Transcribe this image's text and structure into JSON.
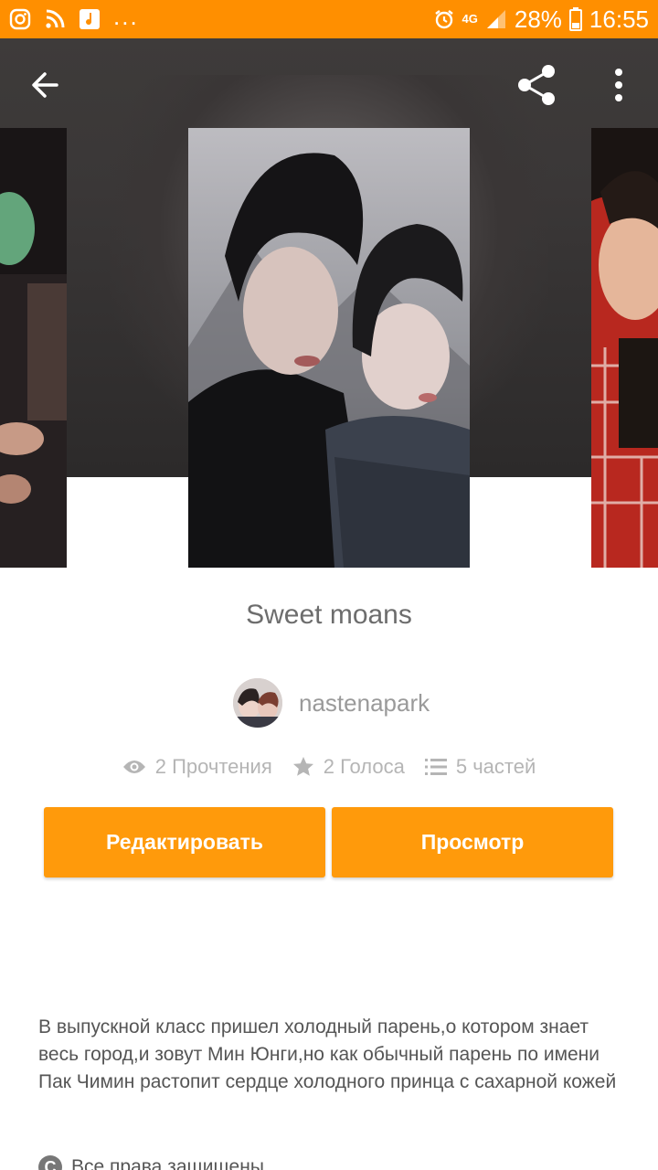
{
  "status_bar": {
    "icons_left": [
      "instagram-icon",
      "rss-icon",
      "music-icon"
    ],
    "more": "...",
    "network": "4G",
    "battery": "28%",
    "time": "16:55"
  },
  "toolbar": {
    "back_icon": "arrow-left-icon",
    "share_icon": "share-icon",
    "more_icon": "more-vertical-icon"
  },
  "story": {
    "title": "Sweet moans",
    "author": "nastenapark",
    "reads": "2 Прочтения",
    "votes": "2 Голоса",
    "parts": "5 частей",
    "edit_label": "Редактировать",
    "view_label": "Просмотр",
    "description": "В выпускной класс пришел холодный парень,о котором знает весь город,и зовут Мин Юнги,но как обычный парень по имени Пак Чимин растопит сердце холодного принца с сахарной кожей",
    "rights": "Все права защищены"
  },
  "colors": {
    "accent": "#ff8f00",
    "button": "#ff9a0b"
  }
}
